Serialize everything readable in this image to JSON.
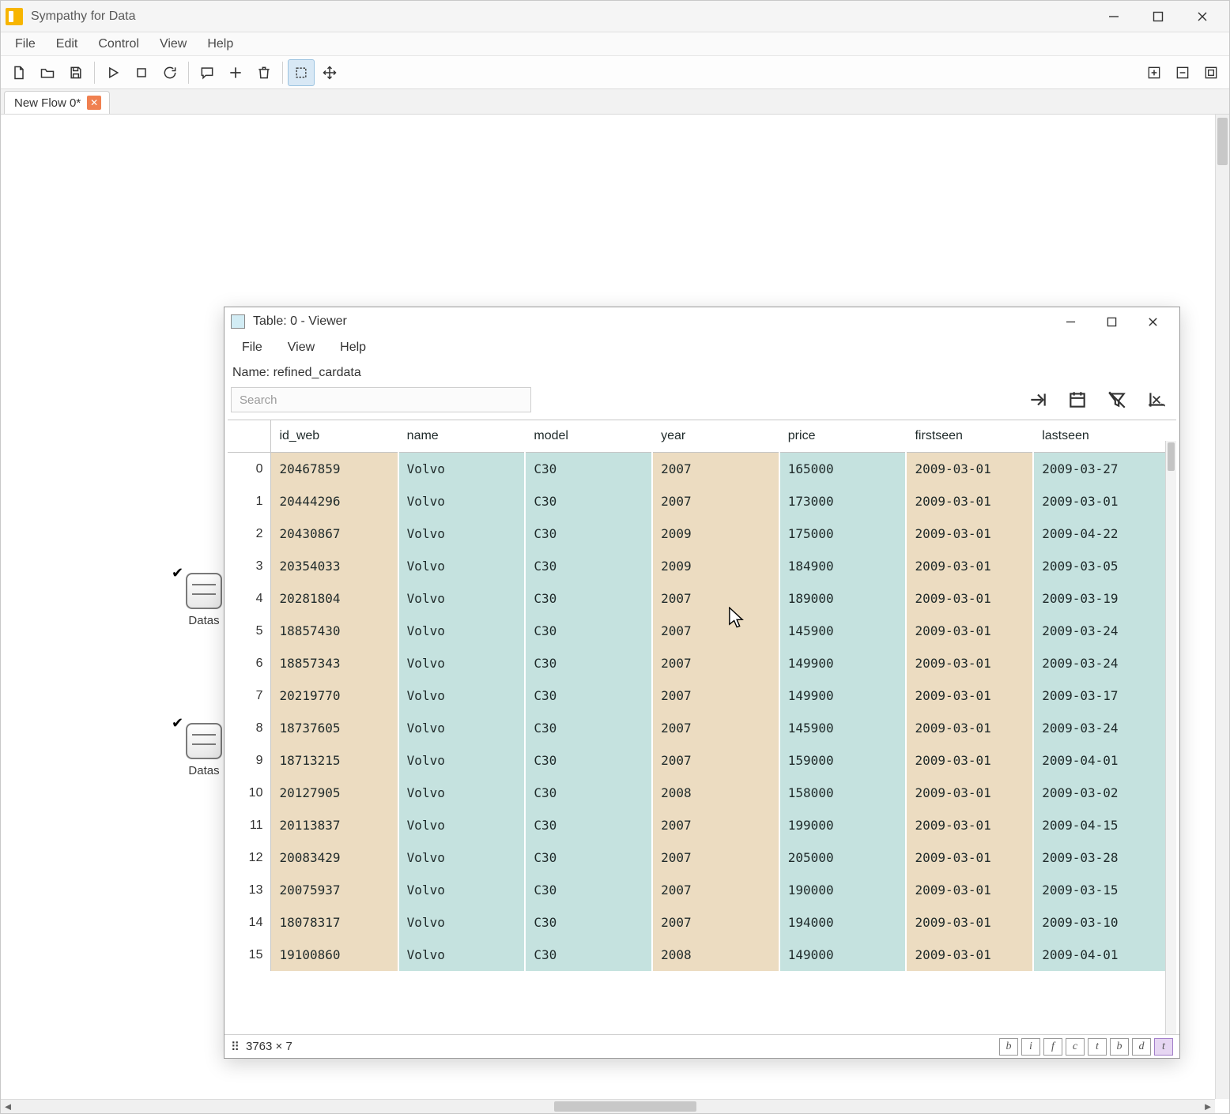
{
  "app": {
    "title": "Sympathy for Data",
    "menus": [
      "File",
      "Edit",
      "Control",
      "View",
      "Help"
    ],
    "tab_label": "New Flow 0*",
    "node_label": "Datas"
  },
  "viewer": {
    "title": "Table: 0 - Viewer",
    "menus": [
      "File",
      "View",
      "Help"
    ],
    "name_prefix": "Name: ",
    "name_value": "refined_cardata",
    "search_placeholder": "Search",
    "status_dims": "3763 × 7",
    "type_badges": [
      "b",
      "i",
      "f",
      "c",
      "t",
      "b",
      "d",
      "t"
    ],
    "columns": [
      "id_web",
      "name",
      "model",
      "year",
      "price",
      "firstseen",
      "lastseen"
    ],
    "col_tints": [
      "tan",
      "teal",
      "teal",
      "tan",
      "teal",
      "tan",
      "teal"
    ],
    "rows": [
      {
        "i": 0,
        "c": [
          "20467859",
          "Volvo",
          "C30",
          "2007",
          "165000",
          "2009-03-01",
          "2009-03-27"
        ]
      },
      {
        "i": 1,
        "c": [
          "20444296",
          "Volvo",
          "C30",
          "2007",
          "173000",
          "2009-03-01",
          "2009-03-01"
        ]
      },
      {
        "i": 2,
        "c": [
          "20430867",
          "Volvo",
          "C30",
          "2009",
          "175000",
          "2009-03-01",
          "2009-04-22"
        ]
      },
      {
        "i": 3,
        "c": [
          "20354033",
          "Volvo",
          "C30",
          "2009",
          "184900",
          "2009-03-01",
          "2009-03-05"
        ]
      },
      {
        "i": 4,
        "c": [
          "20281804",
          "Volvo",
          "C30",
          "2007",
          "189000",
          "2009-03-01",
          "2009-03-19"
        ]
      },
      {
        "i": 5,
        "c": [
          "18857430",
          "Volvo",
          "C30",
          "2007",
          "145900",
          "2009-03-01",
          "2009-03-24"
        ]
      },
      {
        "i": 6,
        "c": [
          "18857343",
          "Volvo",
          "C30",
          "2007",
          "149900",
          "2009-03-01",
          "2009-03-24"
        ]
      },
      {
        "i": 7,
        "c": [
          "20219770",
          "Volvo",
          "C30",
          "2007",
          "149900",
          "2009-03-01",
          "2009-03-17"
        ]
      },
      {
        "i": 8,
        "c": [
          "18737605",
          "Volvo",
          "C30",
          "2007",
          "145900",
          "2009-03-01",
          "2009-03-24"
        ]
      },
      {
        "i": 9,
        "c": [
          "18713215",
          "Volvo",
          "C30",
          "2007",
          "159000",
          "2009-03-01",
          "2009-04-01"
        ]
      },
      {
        "i": 10,
        "c": [
          "20127905",
          "Volvo",
          "C30",
          "2008",
          "158000",
          "2009-03-01",
          "2009-03-02"
        ]
      },
      {
        "i": 11,
        "c": [
          "20113837",
          "Volvo",
          "C30",
          "2007",
          "199000",
          "2009-03-01",
          "2009-04-15"
        ]
      },
      {
        "i": 12,
        "c": [
          "20083429",
          "Volvo",
          "C30",
          "2007",
          "205000",
          "2009-03-01",
          "2009-03-28"
        ]
      },
      {
        "i": 13,
        "c": [
          "20075937",
          "Volvo",
          "C30",
          "2007",
          "190000",
          "2009-03-01",
          "2009-03-15"
        ]
      },
      {
        "i": 14,
        "c": [
          "18078317",
          "Volvo",
          "C30",
          "2007",
          "194000",
          "2009-03-01",
          "2009-03-10"
        ]
      },
      {
        "i": 15,
        "c": [
          "19100860",
          "Volvo",
          "C30",
          "2008",
          "149000",
          "2009-03-01",
          "2009-04-01"
        ]
      }
    ]
  }
}
